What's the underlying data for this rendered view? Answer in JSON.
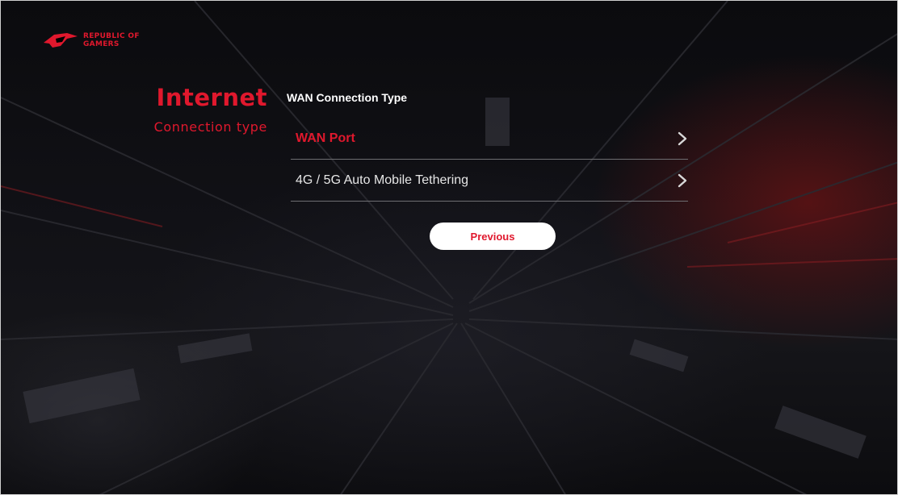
{
  "brand": {
    "logo_icon": "rog-eye-icon",
    "logo_text": "REPUBLIC OF GAMERS"
  },
  "page": {
    "title": "Internet",
    "subtitle": "Connection type"
  },
  "section": {
    "label": "WAN Connection Type"
  },
  "options": [
    {
      "label": "WAN Port",
      "active": true,
      "icon": "chevron-right-icon"
    },
    {
      "label": "4G / 5G Auto Mobile Tethering",
      "active": false,
      "icon": "chevron-right-icon"
    }
  ],
  "actions": {
    "previous_label": "Previous"
  },
  "colors": {
    "accent": "#e0182d",
    "text": "#e6e6e6",
    "divider": "#6e6e72",
    "button_bg": "#ffffff"
  }
}
